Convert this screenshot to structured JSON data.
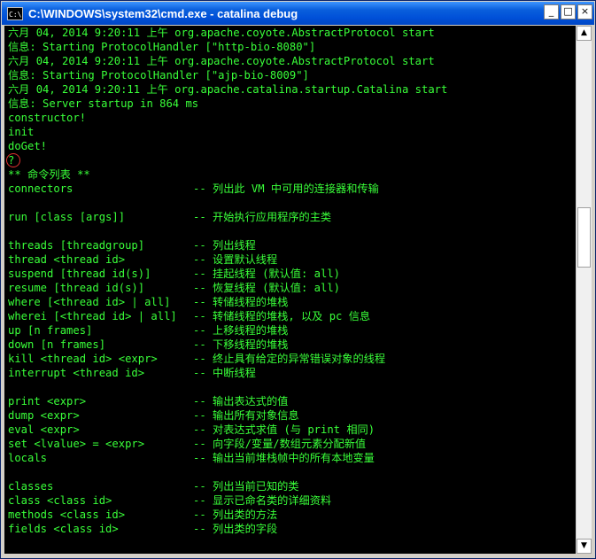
{
  "window": {
    "title": "C:\\WINDOWS\\system32\\cmd.exe - catalina  debug",
    "icon_text": "C:\\",
    "buttons": {
      "minimize": "_",
      "maximize": "□",
      "close": "×"
    }
  },
  "console": {
    "log_lines": [
      "六月 04, 2014 9:20:11 上午 org.apache.coyote.AbstractProtocol start",
      "信息: Starting ProtocolHandler [\"http-bio-8080\"]",
      "六月 04, 2014 9:20:11 上午 org.apache.coyote.AbstractProtocol start",
      "信息: Starting ProtocolHandler [\"ajp-bio-8009\"]",
      "六月 04, 2014 9:20:11 上午 org.apache.catalina.startup.Catalina start",
      "信息: Server startup in 864 ms",
      "constructor!",
      "init",
      "doGet!",
      "?",
      "** 命令列表 **"
    ],
    "commands": [
      {
        "cmd": "connectors",
        "desc": "-- 列出此 VM 中可用的连接器和传输"
      },
      {
        "cmd": "",
        "desc": ""
      },
      {
        "cmd": "run [class [args]]",
        "desc": "-- 开始执行应用程序的主类"
      },
      {
        "cmd": "",
        "desc": ""
      },
      {
        "cmd": "threads [threadgroup]",
        "desc": "-- 列出线程"
      },
      {
        "cmd": "thread <thread id>",
        "desc": "-- 设置默认线程"
      },
      {
        "cmd": "suspend [thread id(s)]",
        "desc": "-- 挂起线程 (默认值: all)"
      },
      {
        "cmd": "resume [thread id(s)]",
        "desc": "-- 恢复线程 (默认值: all)"
      },
      {
        "cmd": "where [<thread id> | all]",
        "desc": "-- 转储线程的堆栈"
      },
      {
        "cmd": "wherei [<thread id> | all]",
        "desc": "-- 转储线程的堆栈, 以及 pc 信息"
      },
      {
        "cmd": "up [n frames]",
        "desc": "-- 上移线程的堆栈"
      },
      {
        "cmd": "down [n frames]",
        "desc": "-- 下移线程的堆栈"
      },
      {
        "cmd": "kill <thread id> <expr>",
        "desc": "-- 终止具有给定的异常错误对象的线程"
      },
      {
        "cmd": "interrupt <thread id>",
        "desc": "-- 中断线程"
      },
      {
        "cmd": "",
        "desc": ""
      },
      {
        "cmd": "print <expr>",
        "desc": "-- 输出表达式的值"
      },
      {
        "cmd": "dump <expr>",
        "desc": "-- 输出所有对象信息"
      },
      {
        "cmd": "eval <expr>",
        "desc": "-- 对表达式求值 (与 print 相同)"
      },
      {
        "cmd": "set <lvalue> = <expr>",
        "desc": "-- 向字段/变量/数组元素分配新值"
      },
      {
        "cmd": "locals",
        "desc": "-- 输出当前堆栈帧中的所有本地变量"
      },
      {
        "cmd": "",
        "desc": ""
      },
      {
        "cmd": "classes",
        "desc": "-- 列出当前已知的类"
      },
      {
        "cmd": "class <class id>",
        "desc": "-- 显示已命名类的详细资料"
      },
      {
        "cmd": "methods <class id>",
        "desc": "-- 列出类的方法"
      },
      {
        "cmd": "fields <class id>",
        "desc": "-- 列出类的字段"
      }
    ]
  },
  "scrollbar": {
    "up_arrow": "▲",
    "down_arrow": "▼",
    "position": 0.38
  },
  "colors": {
    "text": "#39ff39",
    "background": "#000000",
    "highlight_circle": "#e03030",
    "titlebar": "#0050d8"
  }
}
